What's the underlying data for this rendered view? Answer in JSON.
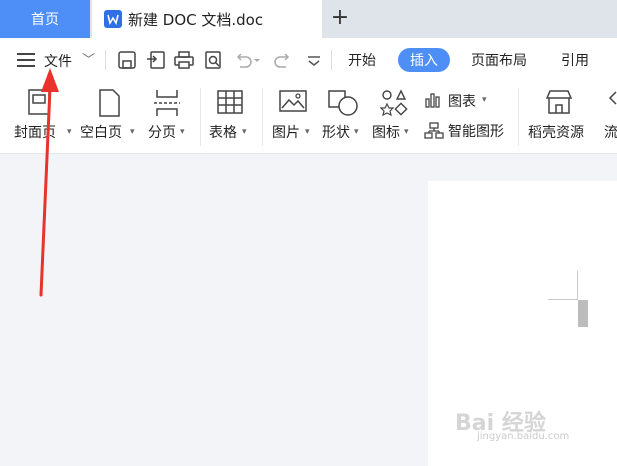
{
  "tabs": {
    "home": "首页",
    "document": "新建 DOC 文档.doc",
    "new_tab": "+"
  },
  "menu": {
    "file": "文件",
    "tabs": [
      "开始",
      "插入",
      "页面布局",
      "引用"
    ],
    "active_tab": "插入"
  },
  "ribbon": {
    "cover": "封面页",
    "blank": "空白页",
    "break": "分页",
    "table": "表格",
    "picture": "图片",
    "shape": "形状",
    "icon": "图标",
    "chart": "图表",
    "smart_art": "智能图形",
    "resources": "稻壳资源",
    "flow": "流"
  },
  "watermark": {
    "text": "Bai 经验",
    "sub": "jingyan.baidu.com"
  },
  "colors": {
    "accent": "#4e8ef7",
    "doc_icon": "#2f6fe8",
    "annotation_arrow": "#e8322b"
  }
}
